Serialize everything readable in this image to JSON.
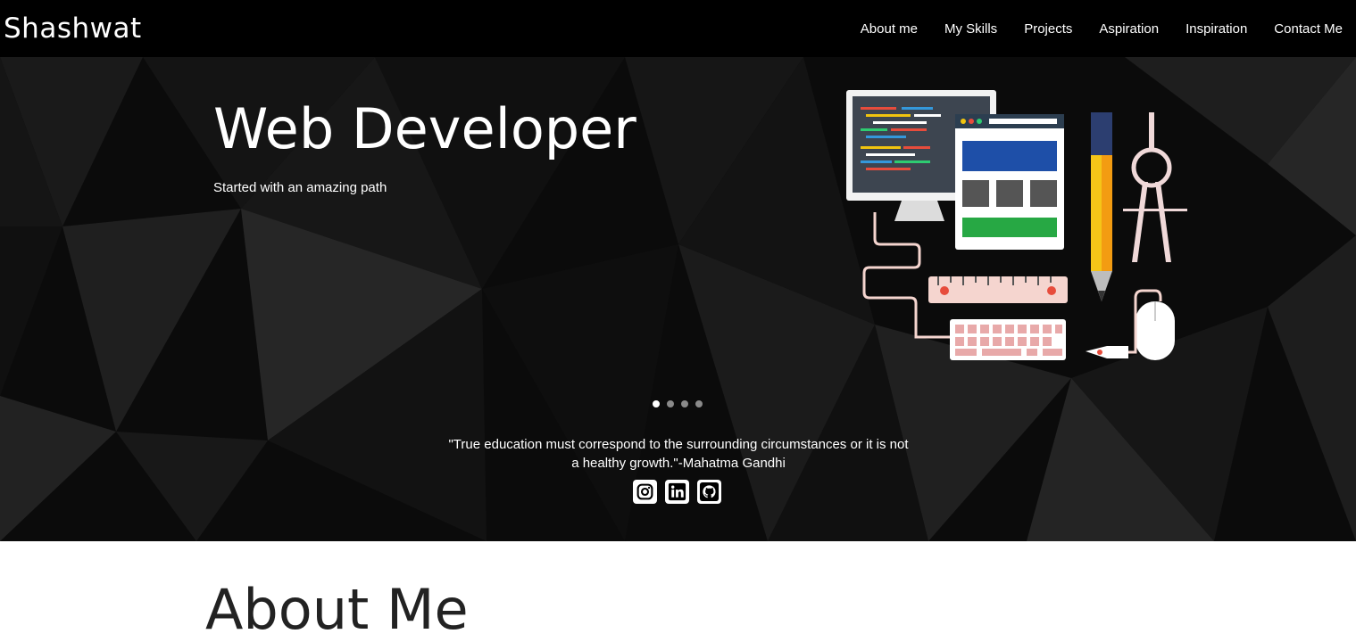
{
  "navbar": {
    "brand": "Shashwat",
    "links": [
      "About me",
      "My Skills",
      "Projects",
      "Aspiration",
      "Inspiration",
      "Contact Me"
    ]
  },
  "hero": {
    "title": "Web Developer",
    "subtitle": "Started with an amazing path",
    "illustration": "web-development-tools-icon",
    "slides_count": 4,
    "active_slide": 1,
    "quote": "\"True education must correspond to the surrounding circumstances or it is not a healthy growth.\"-Mahatma Gandhi",
    "socials": [
      "instagram-icon",
      "linkedin-icon",
      "github-icon"
    ]
  },
  "about": {
    "heading": "About Me"
  },
  "colors": {
    "navbar_bg": "#000000",
    "hero_bg": "#0b0b0b",
    "text": "#ffffff",
    "heading_dark": "#222222"
  }
}
